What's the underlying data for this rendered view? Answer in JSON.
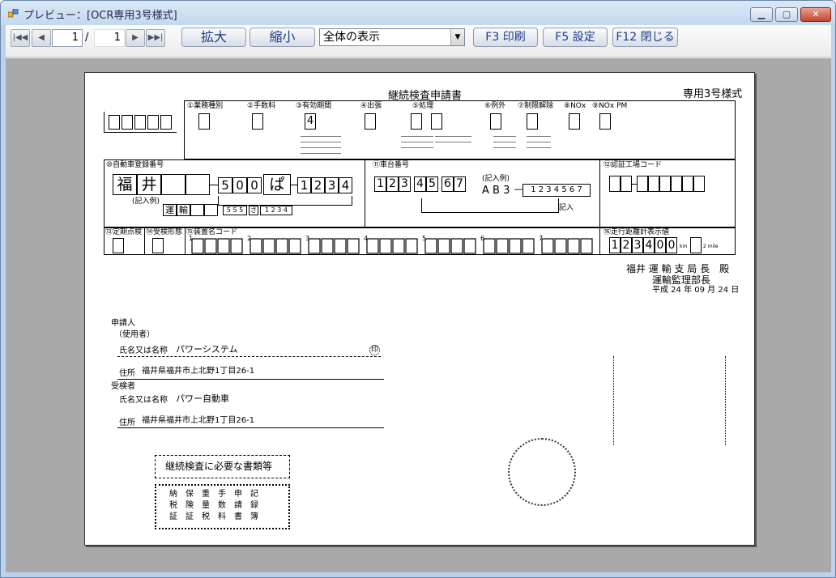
{
  "window": {
    "title": "プレビュー：[OCR専用3号様式]"
  },
  "toolbar": {
    "page_current": "1",
    "page_sep": "/",
    "page_total": "1",
    "zoom_in": "拡大",
    "zoom_out": "縮小",
    "zoom_select": "全体の表示",
    "print": "F3 印刷",
    "settings": "F5 設定",
    "close": "F12 閉じる"
  },
  "form": {
    "title": "継続検査申請書",
    "form_type": "専用3号様式",
    "labels": {
      "l1": "①業務種別",
      "l2": "②手数料",
      "l3": "③有効期間",
      "l4": "④出張",
      "l5": "⑤処理",
      "l6": "⑥例外",
      "l7": "⑦制限解除",
      "l8": "⑧NOx",
      "l9": "⑨NOx PM",
      "l10": "⑩自動車登録番号",
      "l11": "⑪車台番号",
      "l12": "⑫認証工場コード",
      "l13": "⑬定期点検",
      "l14": "⑭受検形態",
      "l15": "⑮装置名コード",
      "l16": "⑯走行距離計表示値",
      "example": "(記入例)",
      "kinyu": "記入"
    },
    "values": {
      "validity": "4",
      "plate_region_1": "福",
      "plate_region_2": "井",
      "class_no": [
        "5",
        "0",
        "0"
      ],
      "kana": "ぱ",
      "serial": [
        "1",
        "2",
        "3",
        "4"
      ],
      "chassis": [
        "1",
        "2",
        "3",
        "4",
        "5",
        "6",
        "7"
      ],
      "chassis_example": "A B 3 －",
      "chassis_example_digits": "1 2 3 4 5 6 7",
      "plate_example_1": "運",
      "plate_example_2": "輸",
      "plate_example_3": "5 5 5",
      "plate_example_4": "さ",
      "plate_example_5": "1 2 3 4",
      "odometer": [
        "1",
        "2",
        "3",
        "4",
        "0",
        "0"
      ],
      "odo_unit_1": "km",
      "odo_unit_2": "2 mile",
      "code_indices": [
        "1",
        "2",
        "3",
        "4",
        "5",
        "6",
        "7"
      ]
    },
    "addressee": {
      "line1": "福井 運 輸 支 局 長　殿",
      "line2": "運輸監理部長",
      "date": "平成 24 年 09 月 24 日"
    },
    "applicant": {
      "section": "申請人",
      "user_label": "（使用者）",
      "name_label": "氏名又は名称",
      "name": "パワーシステム",
      "seal": "印",
      "address_label": "住所",
      "address": "福井県福井市上北野1丁目26-1"
    },
    "inspectee": {
      "section": "受検者",
      "name_label": "氏名又は名称",
      "name": "パワー自動車",
      "address_label": "住所",
      "address": "福井県福井市上北野1丁目26-1"
    },
    "documents": {
      "title": "継続検査に必要な書類等",
      "row1": "納　保　重　手　申　記",
      "row2": "税　険　量　数　請　録",
      "row3": "証　証　税　料　書　簿"
    }
  }
}
